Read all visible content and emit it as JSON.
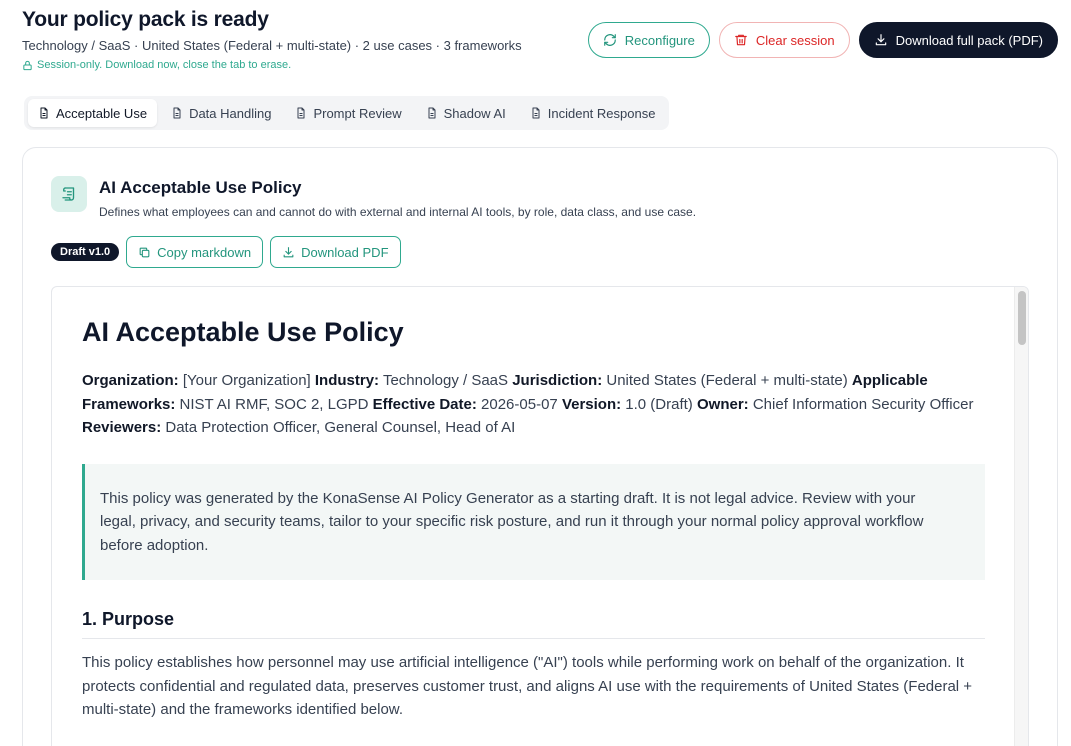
{
  "header": {
    "title": "Your policy pack is ready",
    "subtitle": "Technology / SaaS · United States (Federal + multi-state) · 2 use cases · 3 frameworks",
    "session_note": "Session-only. Download now, close the tab to erase."
  },
  "actions": {
    "reconfigure": "Reconfigure",
    "clear_session": "Clear session",
    "download_full": "Download full pack (PDF)"
  },
  "tabs": [
    {
      "label": "Acceptable Use",
      "active": true
    },
    {
      "label": "Data Handling"
    },
    {
      "label": "Prompt Review"
    },
    {
      "label": "Shadow AI"
    },
    {
      "label": "Incident Response"
    }
  ],
  "policy": {
    "title": "AI Acceptable Use Policy",
    "description": "Defines what employees can and cannot do with external and internal AI tools, by role, data class, and use case.",
    "badge": "Draft v1.0",
    "copy_label": "Copy markdown",
    "download_label": "Download PDF"
  },
  "document": {
    "h1": "AI Acceptable Use Policy",
    "meta": {
      "org_label": "Organization:",
      "org": " [Your Organization] ",
      "industry_label": "Industry:",
      "industry": " Technology / SaaS ",
      "juris_label": "Jurisdiction:",
      "juris": " United States (Federal + multi-state) ",
      "fw_label": "Applicable Frameworks:",
      "fw": " NIST AI RMF, SOC 2, LGPD ",
      "date_label": "Effective Date:",
      "date": " 2026-05-07 ",
      "version_label": "Version:",
      "version": " 1.0 (Draft) ",
      "owner_label": "Owner:",
      "owner": " Chief Information Security Officer ",
      "reviewers_label": "Reviewers:",
      "reviewers": " Data Protection Officer, General Counsel, Head of AI"
    },
    "callout": "This policy was generated by the KonaSense AI Policy Generator as a starting draft. It is not legal advice. Review with your legal, privacy, and security teams, tailor to your specific risk posture, and run it through your normal policy approval workflow before adoption.",
    "section1_title": "1. Purpose",
    "section1_text": "This policy establishes how personnel may use artificial intelligence (\"AI\") tools while performing work on behalf of the organization. It protects confidential and regulated data, preserves customer trust, and aligns AI use with the requirements of United States (Federal + multi-state) and the frameworks identified below."
  },
  "colors": {
    "accent": "#2fa98f",
    "danger": "#dc2626",
    "dark": "#0f172a"
  }
}
